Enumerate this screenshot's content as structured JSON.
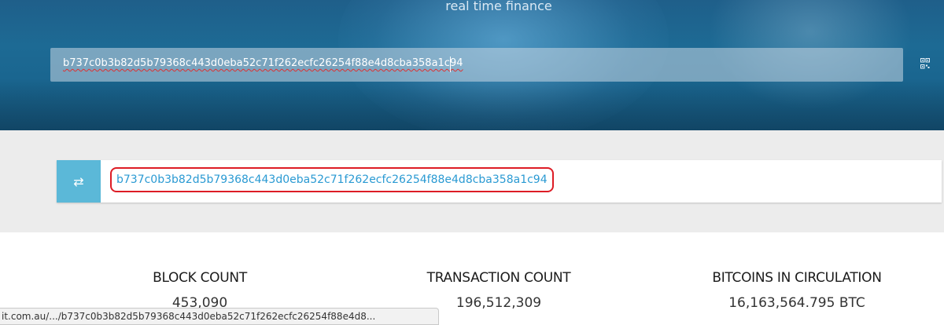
{
  "header": {
    "tagline": "real time finance",
    "search": {
      "value": "b737c0b3b82d5b79368c443d0eba52c71f262ecfc26254f88e4d8cba358a1c94"
    },
    "qr_icon": "qr-code-icon"
  },
  "result": {
    "badge_icon": "transfer-arrows-icon",
    "badge_glyph": "⇄",
    "hash": "b737c0b3b82d5b79368c443d0eba52c71f262ecfc26254f88e4d8cba358a1c94",
    "highlight_color": "#dd1c25",
    "link_color": "#2a9ad3"
  },
  "stats": [
    {
      "label": "BLOCK COUNT",
      "value": "453,090"
    },
    {
      "label": "TRANSACTION COUNT",
      "value": "196,512,309"
    },
    {
      "label": "BITCOINS IN CIRCULATION",
      "value": "16,163,564.795 BTC"
    }
  ],
  "status_bar": {
    "url": "it.com.au/.../b737c0b3b82d5b79368c443d0eba52c71f262ecfc26254f88e4d8..."
  }
}
